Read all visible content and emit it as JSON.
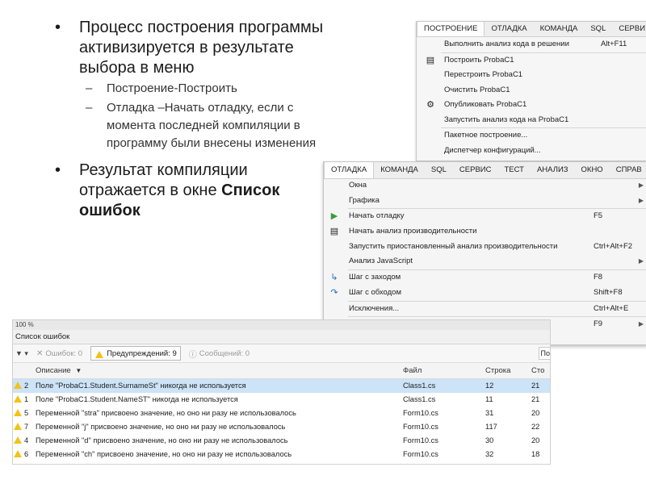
{
  "slide": {
    "bullet1": "Процесс построения программы активизируется в результате выбора в меню",
    "sub1": "Построение-Построить",
    "sub2": "Отладка –Начать отладку, если с момента последней компиляции в программу были внесены изменения",
    "bullet2_text": "Результат компиляции отражается в окне ",
    "bullet2_bold": "Список ошибок",
    "bullet_glyph": "•",
    "dash_glyph": "–"
  },
  "build_menu": {
    "menubar": [
      "ПОСТРОЕНИЕ",
      "ОТЛАДКА",
      "КОМАНДА",
      "SQL",
      "СЕРВИ"
    ],
    "items": [
      {
        "label": "Выполнить анализ кода в решении",
        "shortcut": "Alt+F11",
        "icon": ""
      },
      {
        "label": "Построить ProbaC1",
        "shortcut": "",
        "icon": "build-icon"
      },
      {
        "label": "Перестроить ProbaC1",
        "shortcut": "",
        "icon": ""
      },
      {
        "label": "Очистить ProbaC1",
        "shortcut": "",
        "icon": ""
      },
      {
        "label": "Опубликовать ProbaC1",
        "shortcut": "",
        "icon": "publish-icon"
      },
      {
        "label": "Запустить анализ кода на ProbaC1",
        "shortcut": "",
        "icon": ""
      },
      {
        "label": "Пакетное построение...",
        "shortcut": "",
        "icon": ""
      },
      {
        "label": "Диспетчер конфигураций...",
        "shortcut": "",
        "icon": ""
      }
    ]
  },
  "debug_menu": {
    "menubar": [
      "ОТЛАДКА",
      "КОМАНДА",
      "SQL",
      "СЕРВИС",
      "ТЕСТ",
      "АНАЛИЗ",
      "ОКНО",
      "СПРАВ"
    ],
    "items": [
      {
        "label": "Окна",
        "shortcut": "",
        "icon": "",
        "submenu": true
      },
      {
        "label": "Графика",
        "shortcut": "",
        "icon": "",
        "submenu": true
      },
      {
        "label": "Начать отладку",
        "shortcut": "F5",
        "icon": "play-icon",
        "submenu": false
      },
      {
        "label": "Начать анализ производительности",
        "shortcut": "",
        "icon": "performance-icon",
        "submenu": false
      },
      {
        "label": "Запустить приостановленный анализ производительности",
        "shortcut": "Ctrl+Alt+F2",
        "icon": "",
        "submenu": false
      },
      {
        "label": "Анализ JavaScript",
        "shortcut": "",
        "icon": "",
        "submenu": true
      },
      {
        "label": "Шаг с заходом",
        "shortcut": "F8",
        "icon": "step-into-icon",
        "submenu": false
      },
      {
        "label": "Шаг с обходом",
        "shortcut": "Shift+F8",
        "icon": "step-over-icon",
        "submenu": false
      },
      {
        "label": "Исключения...",
        "shortcut": "Ctrl+Alt+E",
        "icon": "",
        "submenu": false
      },
      {
        "label": "",
        "shortcut": "F9",
        "icon": "",
        "submenu": true
      }
    ]
  },
  "error_list": {
    "zoom": "100 %",
    "title": "Список ошибок",
    "filters": {
      "errors": "Ошибок: 0",
      "warnings": "Предупреждений: 9",
      "messages": "Сообщений: 0"
    },
    "search_stub": "По",
    "columns": [
      "Описание",
      "Файл",
      "Строка",
      "Сто"
    ],
    "rows": [
      {
        "n": "2",
        "desc": "Поле \"ProbaC1.Student.SurnameSt\" никогда не используется",
        "file": "Class1.cs",
        "line": "12",
        "col": "21"
      },
      {
        "n": "1",
        "desc": "Поле \"ProbaC1.Student.NameST\" никогда не используется",
        "file": "Class1.cs",
        "line": "11",
        "col": "21"
      },
      {
        "n": "5",
        "desc": "Переменной \"stra\" присвоено значение, но оно ни разу не использовалось",
        "file": "Form10.cs",
        "line": "31",
        "col": "20"
      },
      {
        "n": "7",
        "desc": "Переменной \"j\" присвоено значение, но оно ни разу не использовалось",
        "file": "Form10.cs",
        "line": "117",
        "col": "22"
      },
      {
        "n": "4",
        "desc": "Переменной \"d\" присвоено значение, но оно ни разу не использовалось",
        "file": "Form10.cs",
        "line": "30",
        "col": "20"
      },
      {
        "n": "6",
        "desc": "Переменной \"ch\" присвоено значение, но оно ни разу не использовалось",
        "file": "Form10.cs",
        "line": "32",
        "col": "18"
      }
    ]
  }
}
